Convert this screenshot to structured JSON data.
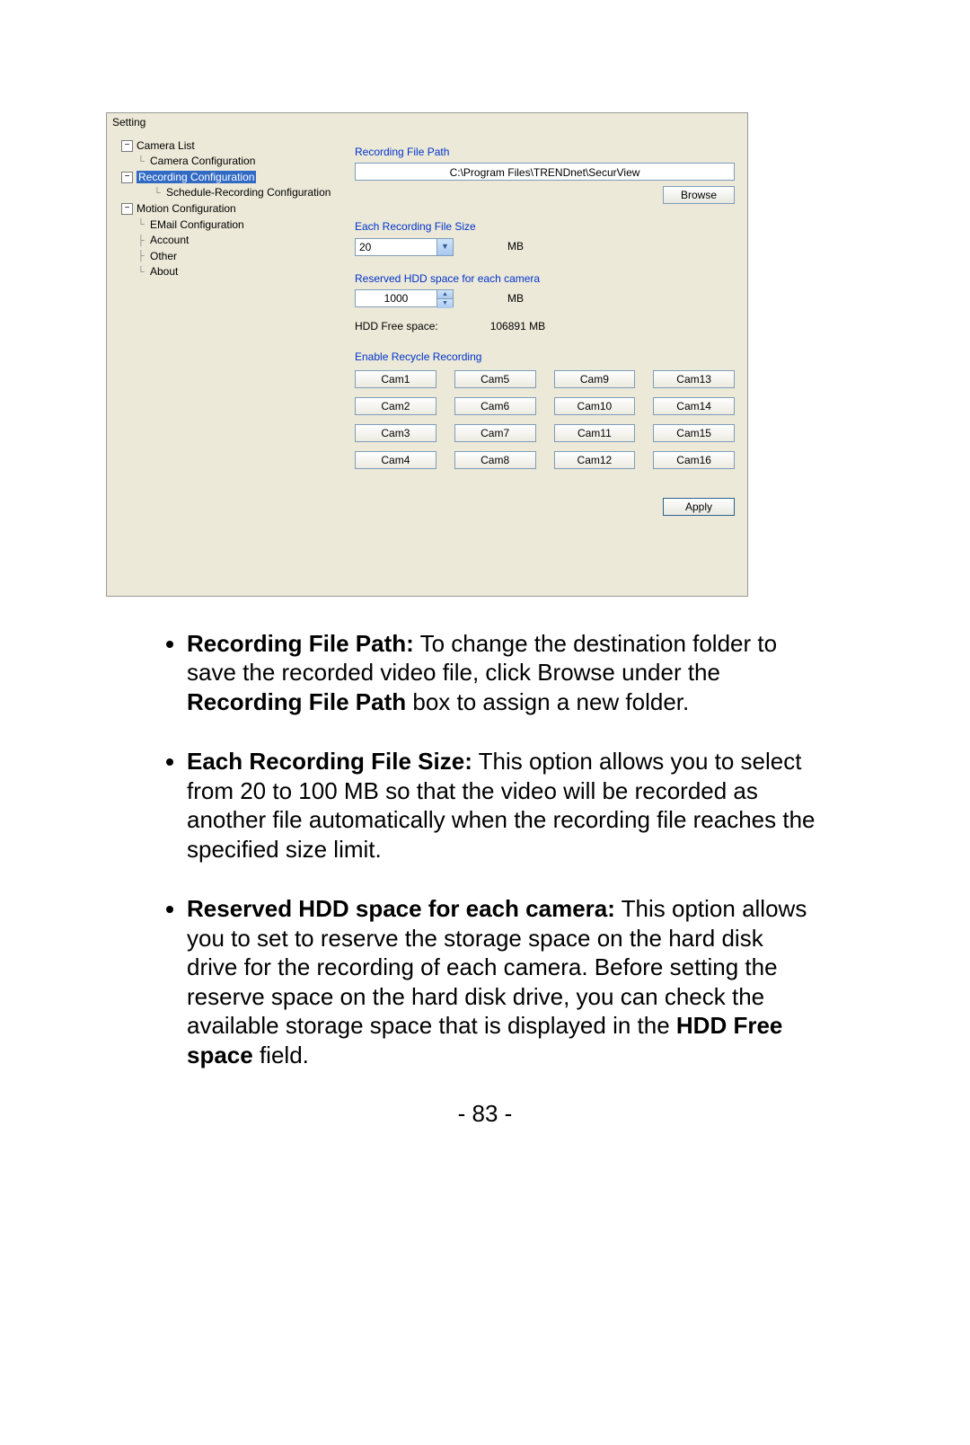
{
  "dialog": {
    "title": "Setting",
    "tree": {
      "items": [
        {
          "level": 0,
          "expander": "−",
          "label": "Camera List",
          "id": "camera-list"
        },
        {
          "level": 1,
          "expander": null,
          "label": "Camera Configuration",
          "id": "camera-configuration"
        },
        {
          "level": 0,
          "expander": "−",
          "label": "Recording Configuration",
          "id": "recording-configuration",
          "selected": true
        },
        {
          "level": 1,
          "expander": null,
          "label": "Schedule-Recording Configuration",
          "id": "schedule-recording-configuration"
        },
        {
          "level": 0,
          "expander": "−",
          "label": "Motion Configuration",
          "id": "motion-configuration"
        },
        {
          "level": 1,
          "expander": null,
          "label": "EMail Configuration",
          "id": "email-configuration"
        },
        {
          "level": 0,
          "expander": null,
          "label": "Account",
          "id": "account",
          "leaf": true
        },
        {
          "level": 0,
          "expander": null,
          "label": "Other",
          "id": "other",
          "leaf": true
        },
        {
          "level": 0,
          "expander": null,
          "label": "About",
          "id": "about",
          "leaf": true
        }
      ]
    },
    "path": {
      "heading": "Recording File Path",
      "value": "C:\\Program Files\\TRENDnet\\SecurView",
      "browse": "Browse"
    },
    "filesize": {
      "heading": "Each Recording File Size",
      "value": "20",
      "unit": "MB"
    },
    "reserved": {
      "heading": "Reserved HDD space for each camera",
      "value": "1000",
      "unit": "MB"
    },
    "free": {
      "label": "HDD Free space:",
      "value": "106891",
      "unit": "MB"
    },
    "recycle": {
      "heading": "Enable Recycle Recording",
      "cams": [
        "Cam1",
        "Cam5",
        "Cam9",
        "Cam13",
        "Cam2",
        "Cam6",
        "Cam10",
        "Cam14",
        "Cam3",
        "Cam7",
        "Cam11",
        "Cam15",
        "Cam4",
        "Cam8",
        "Cam12",
        "Cam16"
      ]
    },
    "apply": "Apply"
  },
  "doc": {
    "items": [
      {
        "bold": "Recording File Path:",
        "text": "  To change the destination folder to save the recorded video file, click Browse under the ",
        "bold2": "Recording File Path",
        "tail": " box to assign a new folder."
      },
      {
        "bold": "Each Recording File Size:",
        "text": "  This option allows you to select from 20 to 100 MB so that the video will be recorded as another file automatically when the recording file reaches the specified size limit.",
        "bold2": "",
        "tail": ""
      },
      {
        "bold": "Reserved HDD space for each camera:",
        "text": "  This option allows you to set to reserve the storage space on the hard disk drive for the recording of each camera.  Before setting the reserve space on the hard disk drive, you can check the available storage space that is displayed in the ",
        "bold2": "HDD Free space",
        "tail": " field."
      }
    ]
  },
  "page": "- 83 -"
}
